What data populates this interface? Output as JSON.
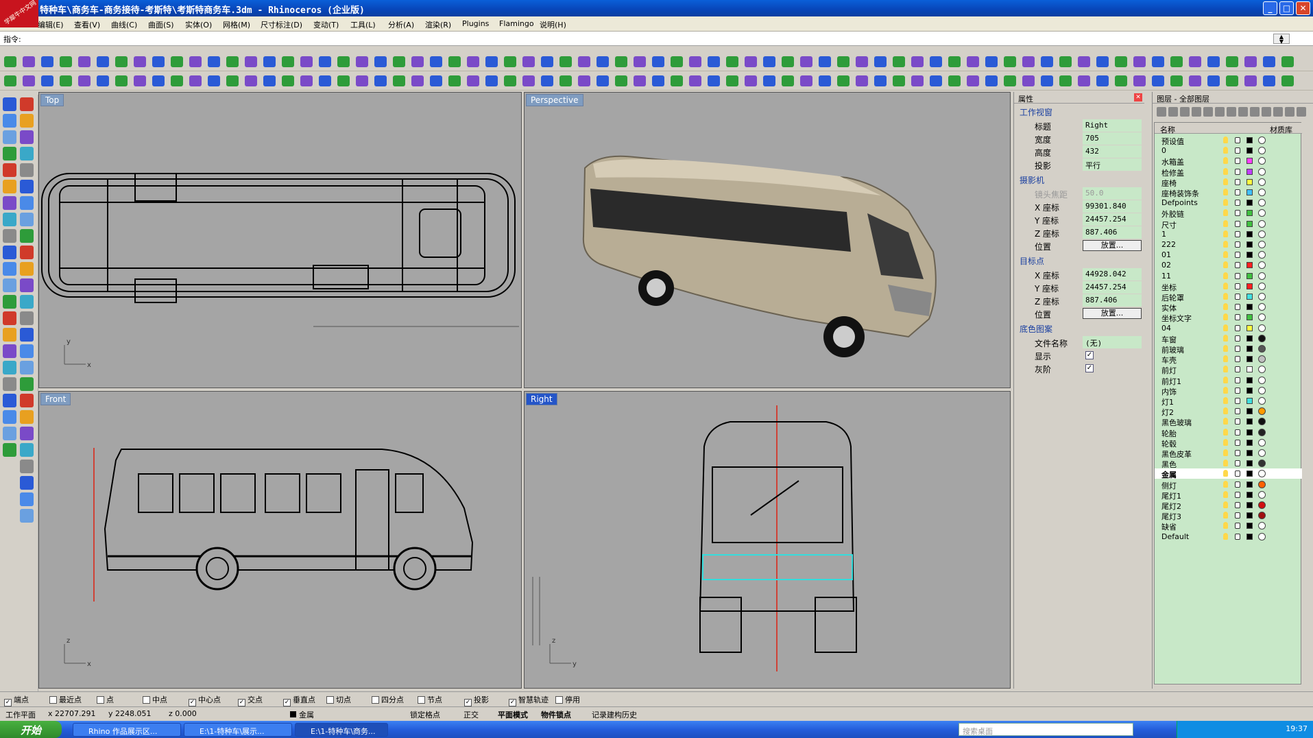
{
  "title": "特种车\\商务车-商务接待-考斯特\\考斯特商务车.3dm - Rhinoceros (企业版)",
  "badge": "学犀牛中文网",
  "menu": [
    "编辑(E)",
    "查看(V)",
    "曲线(C)",
    "曲面(S)",
    "实体(O)",
    "网格(M)",
    "尺寸标注(D)",
    "变动(T)",
    "工具(L)",
    "分析(A)",
    "渲染(R)",
    "Plugins",
    "Flamingo",
    "说明(H)"
  ],
  "command_label": "指令:",
  "viewports": {
    "top": "Top",
    "perspective": "Perspective",
    "front": "Front",
    "right": "Right"
  },
  "props": {
    "header": "属性",
    "viewport_section": "工作视窗",
    "title_k": "标题",
    "title_v": "Right",
    "width_k": "宽度",
    "width_v": "705",
    "height_k": "高度",
    "height_v": "432",
    "proj_k": "投影",
    "proj_v": "平行",
    "camera_section": "摄影机",
    "lens_k": "镜头焦距",
    "lens_v": "50.0",
    "cx_k": "X 座标",
    "cx_v": "99301.840",
    "cy_k": "Y 座标",
    "cy_v": "24457.254",
    "cz_k": "Z 座标",
    "cz_v": "887.406",
    "cpos_k": "位置",
    "cpos_btn": "放置...",
    "target_section": "目标点",
    "tx_k": "X 座标",
    "tx_v": "44928.042",
    "ty_k": "Y 座标",
    "ty_v": "24457.254",
    "tz_k": "Z 座标",
    "tz_v": "887.406",
    "tpos_k": "位置",
    "tpos_btn": "放置...",
    "bg_section": "底色图案",
    "file_k": "文件名称",
    "file_v": "(无)",
    "show_k": "显示",
    "gray_k": "灰阶"
  },
  "layers": {
    "header": "图层 - 全部图层",
    "col_name": "名称",
    "col_mat": "材质库",
    "items": [
      {
        "name": "预设值",
        "color": "#000000",
        "mat": "#ffffff"
      },
      {
        "name": "0",
        "color": "#000000",
        "mat": "#ffffff"
      },
      {
        "name": "水箱盖",
        "color": "#ff40ff",
        "mat": "#ffffff"
      },
      {
        "name": "检修盖",
        "color": "#c040ff",
        "mat": "#ffffff"
      },
      {
        "name": "座椅",
        "color": "#ffff40",
        "mat": "#ffffff"
      },
      {
        "name": "座椅装饰条",
        "color": "#40c0ff",
        "mat": "#ffffff"
      },
      {
        "name": "Defpoints",
        "color": "#000000",
        "mat": "#ffffff"
      },
      {
        "name": "外胶链",
        "color": "#40c040",
        "mat": "#ffffff"
      },
      {
        "name": "尺寸",
        "color": "#40c040",
        "mat": "#ffffff"
      },
      {
        "name": "1",
        "color": "#000000",
        "mat": "#ffffff"
      },
      {
        "name": "222",
        "color": "#000000",
        "mat": "#ffffff"
      },
      {
        "name": "01",
        "color": "#000000",
        "mat": "#ffffff"
      },
      {
        "name": "02",
        "color": "#ff2020",
        "mat": "#ffffff"
      },
      {
        "name": "11",
        "color": "#40c040",
        "mat": "#ffffff"
      },
      {
        "name": "坐标",
        "color": "#ff2020",
        "mat": "#ffffff"
      },
      {
        "name": "后轮罩",
        "color": "#40e0e0",
        "mat": "#ffffff"
      },
      {
        "name": "实体",
        "color": "#000000",
        "mat": "#ffffff"
      },
      {
        "name": "坐标文字",
        "color": "#40c040",
        "mat": "#ffffff"
      },
      {
        "name": "04",
        "color": "#ffff40",
        "mat": "#ffffff"
      },
      {
        "name": "车窗",
        "color": "#000000",
        "mat": "#111111"
      },
      {
        "name": "前玻璃",
        "color": "#000000",
        "mat": "#555555"
      },
      {
        "name": "车壳",
        "color": "#000000",
        "mat": "#c0c0c0"
      },
      {
        "name": "前灯",
        "color": "#ffffff",
        "mat": "#ffffff"
      },
      {
        "name": "前灯1",
        "color": "#000000",
        "mat": "#ffffff"
      },
      {
        "name": "内饰",
        "color": "#000000",
        "mat": "#ffffff"
      },
      {
        "name": "灯1",
        "color": "#40e0e0",
        "mat": "#ffffff"
      },
      {
        "name": "灯2",
        "color": "#000000",
        "mat": "#ff9a00"
      },
      {
        "name": "黑色玻璃",
        "color": "#000000",
        "mat": "#111111"
      },
      {
        "name": "轮胎",
        "color": "#000000",
        "mat": "#222222"
      },
      {
        "name": "轮毂",
        "color": "#000000",
        "mat": "#ffffff"
      },
      {
        "name": "黑色皮革",
        "color": "#000000",
        "mat": "#ffffff"
      },
      {
        "name": "黑色",
        "color": "#000000",
        "mat": "#333333"
      },
      {
        "name": "金属",
        "color": "#000000",
        "mat": "#ffffff",
        "current": true
      },
      {
        "name": "侧灯",
        "color": "#000000",
        "mat": "#ff6000"
      },
      {
        "name": "尾灯1",
        "color": "#000000",
        "mat": "#ffffff"
      },
      {
        "name": "尾灯2",
        "color": "#000000",
        "mat": "#d01010"
      },
      {
        "name": "尾灯3",
        "color": "#000000",
        "mat": "#a01010"
      },
      {
        "name": "缺省",
        "color": "#000000",
        "mat": "#ffffff"
      },
      {
        "name": "Default",
        "color": "#000000",
        "mat": "#ffffff"
      }
    ]
  },
  "osnap": [
    {
      "label": "端点",
      "checked": true
    },
    {
      "label": "最近点",
      "checked": false
    },
    {
      "label": "点",
      "checked": false
    },
    {
      "label": "中点",
      "checked": false
    },
    {
      "label": "中心点",
      "checked": true
    },
    {
      "label": "交点",
      "checked": true
    },
    {
      "label": "垂直点",
      "checked": true
    },
    {
      "label": "切点",
      "checked": false
    },
    {
      "label": "四分点",
      "checked": false
    },
    {
      "label": "节点",
      "checked": false
    },
    {
      "label": "投影",
      "checked": true
    },
    {
      "label": "智慧轨迹",
      "checked": true
    },
    {
      "label": "停用",
      "checked": false
    }
  ],
  "status": {
    "plane": "工作平面",
    "x": "x 22707.291",
    "y": "y 2248.051",
    "z": "z 0.000",
    "layer": "金属",
    "lock": "锁定格点",
    "ortho": "正交",
    "planar": "平面模式",
    "osnap": "物件锁点",
    "history": "记录建构历史"
  },
  "taskbar": {
    "start": "开始",
    "tasks": [
      "Rhino 作品展示区...",
      "E:\\1-特种车\\展示...",
      "E:\\1-特种车\\商务..."
    ],
    "search": "搜索桌面",
    "clock": "19:37"
  },
  "colors": {
    "accent": "#0a5fd8",
    "panel_green": "#c8e8c8",
    "viewport_bg": "#a5a5a5"
  }
}
